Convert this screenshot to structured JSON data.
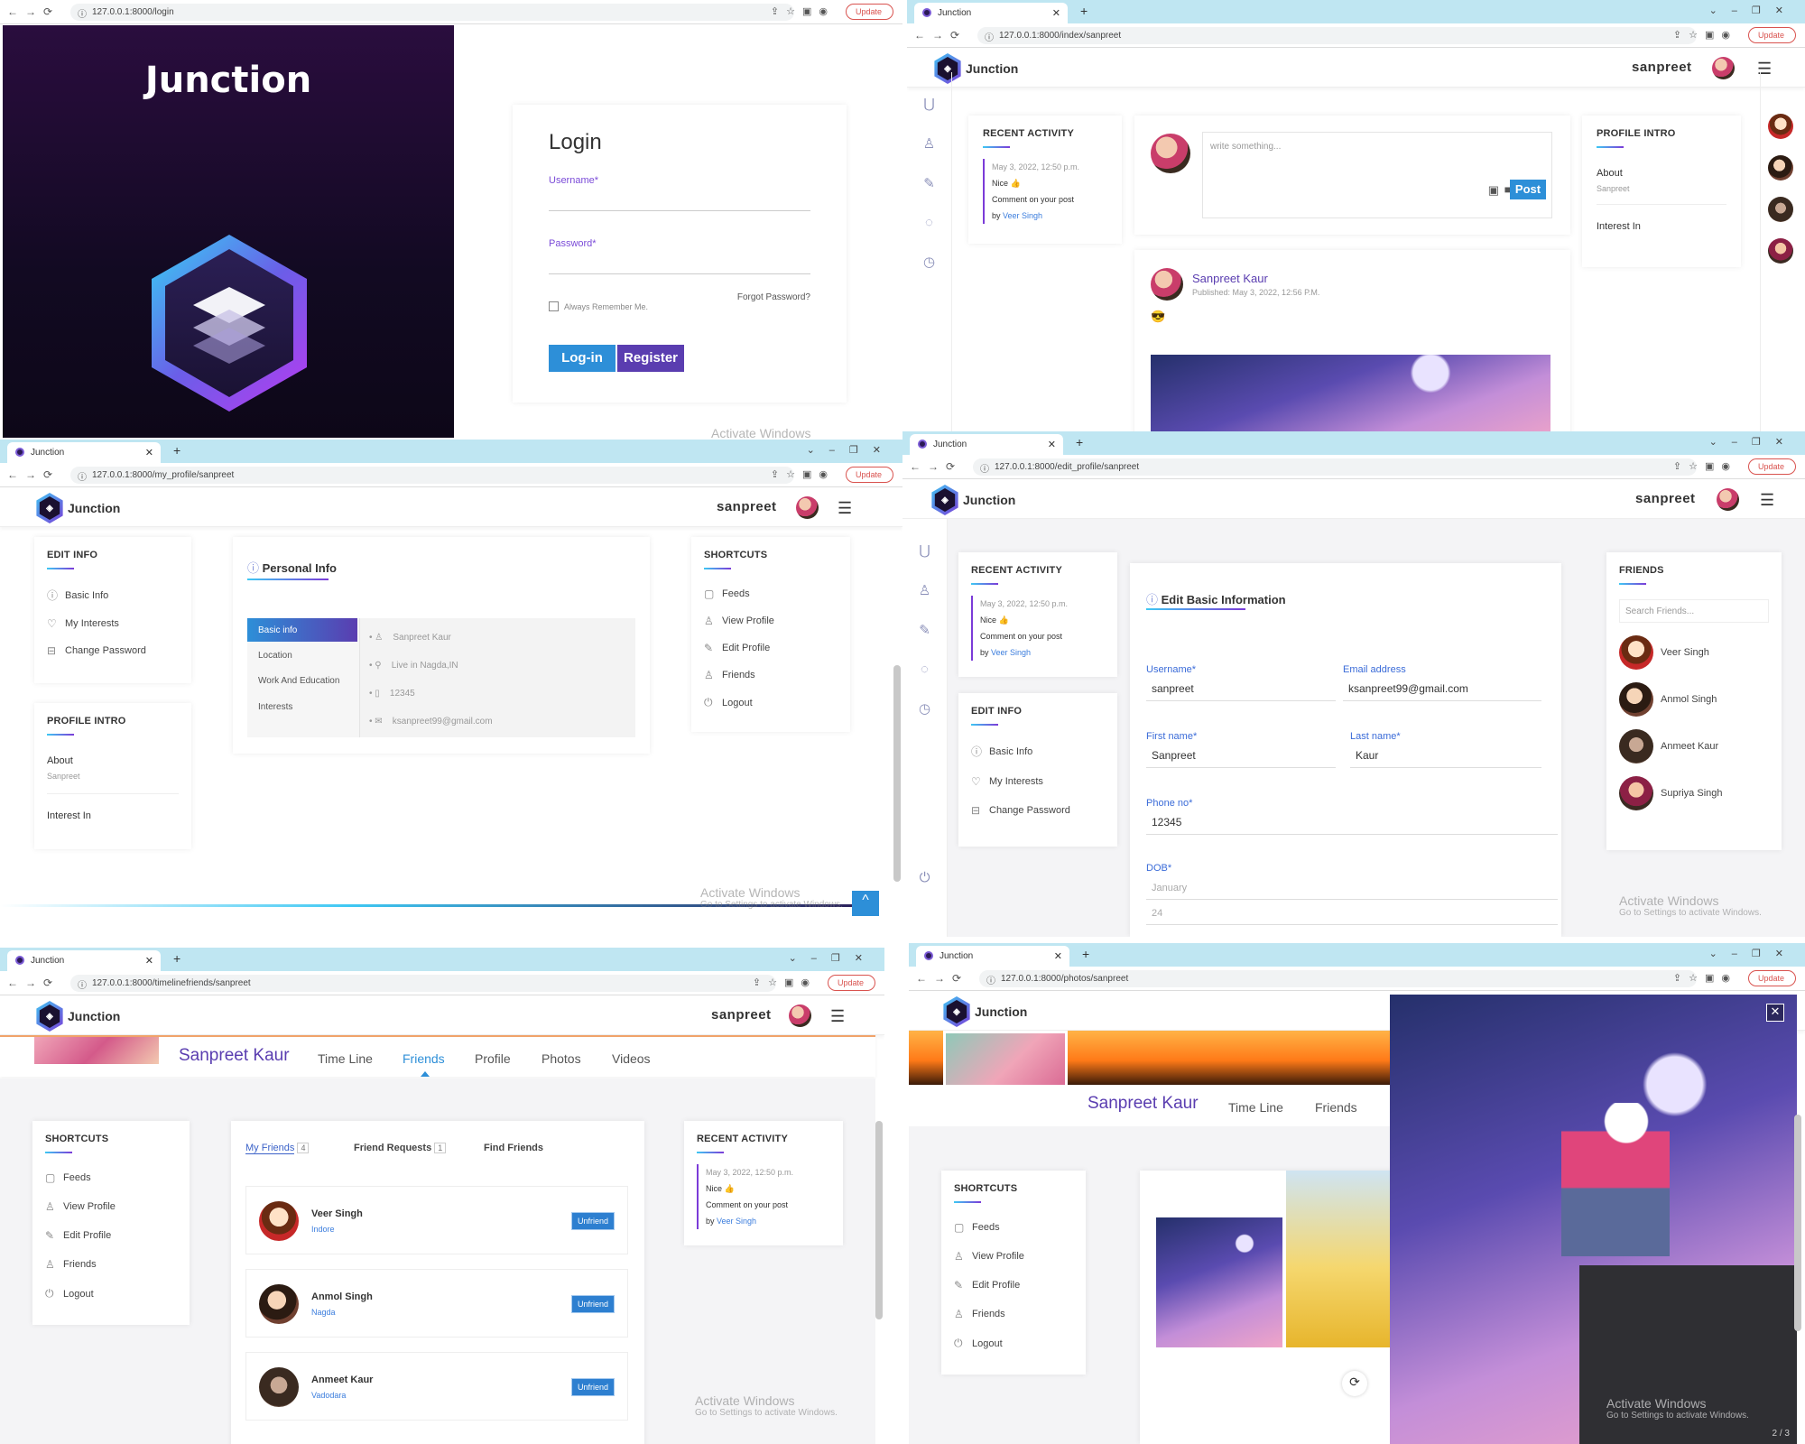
{
  "brand": "Junction",
  "username": "sanpreet",
  "browser": {
    "tab_title": "Junction",
    "update_label": "Update"
  },
  "login": {
    "url": "127.0.0.1:8000/login",
    "title": "Login",
    "username_label": "Username*",
    "password_label": "Password*",
    "remember_label": "Always Remember Me.",
    "forgot_label": "Forgot Password?",
    "login_button": "Log-in",
    "register_button": "Register",
    "watermark": "Activate Windows"
  },
  "index": {
    "url": "127.0.0.1:8000/index/sanpreet",
    "recent_activity": {
      "title": "RECENT ACTIVITY",
      "date": "May 3, 2022, 12:50 p.m.",
      "text": "Nice 👍",
      "action": "Comment on your post",
      "by_prefix": "by",
      "by_name": "Veer Singh"
    },
    "composer": {
      "placeholder": "write something...",
      "post_button": "Post"
    },
    "post": {
      "author": "Sanpreet Kaur",
      "published": "Published: May 3, 2022, 12:56 P.M.",
      "emoji": "😎"
    },
    "profile_intro": {
      "title": "PROFILE INTRO",
      "about_label": "About",
      "about_value": "Sanpreet",
      "interest_label": "Interest In"
    }
  },
  "my_profile": {
    "url": "127.0.0.1:8000/my_profile/sanpreet",
    "edit_info": {
      "title": "EDIT INFO",
      "items": [
        "Basic Info",
        "My Interests",
        "Change Password"
      ]
    },
    "profile_intro": {
      "title": "PROFILE INTRO",
      "about_label": "About",
      "about_value": "Sanpreet",
      "interest_label": "Interest In"
    },
    "personal_info": {
      "title": "Personal Info",
      "tabs": [
        "Basic info",
        "Location",
        "Work And Education",
        "Interests"
      ],
      "values": [
        "Sanpreet Kaur",
        "Live in Nagda,IN",
        "12345",
        "ksanpreet99@gmail.com"
      ]
    },
    "shortcuts": {
      "title": "SHORTCUTS",
      "items": [
        "Feeds",
        "View Profile",
        "Edit Profile",
        "Friends",
        "Logout"
      ]
    },
    "watermark": "Activate Windows",
    "watermark_sub": "Go to Settings to activate Windows."
  },
  "edit_profile": {
    "url": "127.0.0.1:8000/edit_profile/sanpreet",
    "recent_activity": {
      "title": "RECENT ACTIVITY",
      "date": "May 3, 2022, 12:50 p.m.",
      "text": "Nice 👍",
      "action": "Comment on your post",
      "by_prefix": "by",
      "by_name": "Veer Singh"
    },
    "edit_info": {
      "title": "EDIT INFO",
      "items": [
        "Basic Info",
        "My Interests",
        "Change Password"
      ]
    },
    "form": {
      "title": "Edit Basic Information",
      "username_label": "Username*",
      "username": "sanpreet",
      "email_label": "Email address",
      "email": "ksanpreet99@gmail.com",
      "first_label": "First name*",
      "first": "Sanpreet",
      "last_label": "Last name*",
      "last": "Kaur",
      "phone_label": "Phone no*",
      "phone": "12345",
      "dob_label": "DOB*",
      "dob_month": "January",
      "dob_day": "24"
    },
    "friends": {
      "title": "FRIENDS",
      "search_placeholder": "Search Friends...",
      "list": [
        "Veer Singh",
        "Anmol Singh",
        "Anmeet Kaur",
        "Supriya Singh"
      ]
    },
    "watermark": "Activate Windows",
    "watermark_sub": "Go to Settings to activate Windows."
  },
  "timeline_friends": {
    "url": "127.0.0.1:8000/timelinefriends/sanpreet",
    "profile_name": "Sanpreet Kaur",
    "tabs": [
      "Time Line",
      "Friends",
      "Profile",
      "Photos",
      "Videos"
    ],
    "shortcuts": {
      "title": "SHORTCUTS",
      "items": [
        "Feeds",
        "View Profile",
        "Edit Profile",
        "Friends",
        "Logout"
      ]
    },
    "friend_tabs": {
      "my_friends": "My Friends",
      "my_friends_count": "4",
      "requests": "Friend Requests",
      "requests_count": "1",
      "find": "Find Friends"
    },
    "friends": [
      {
        "name": "Veer Singh",
        "city": "Indore"
      },
      {
        "name": "Anmol Singh",
        "city": "Nagda"
      },
      {
        "name": "Anmeet Kaur",
        "city": "Vadodara"
      }
    ],
    "unfriend_label": "Unfriend",
    "recent_activity": {
      "title": "RECENT ACTIVITY",
      "date": "May 3, 2022, 12:50 p.m.",
      "text": "Nice 👍",
      "action": "Comment on your post",
      "by_prefix": "by",
      "by_name": "Veer Singh"
    },
    "watermark": "Activate Windows",
    "watermark_sub": "Go to Settings to activate Windows."
  },
  "photos": {
    "url": "127.0.0.1:8000/photos/sanpreet",
    "profile_name": "Sanpreet Kaur",
    "tabs": [
      "Time Line",
      "Friends"
    ],
    "shortcuts": {
      "title": "SHORTCUTS",
      "items": [
        "Feeds",
        "View Profile",
        "Edit Profile",
        "Friends",
        "Logout"
      ]
    },
    "lightbox_counter": "2 / 3",
    "watermark": "Activate Windows",
    "watermark_sub": "Go to Settings to activate Windows."
  },
  "icons": {
    "shortcuts": [
      "file-icon",
      "user-icon",
      "edit-icon",
      "user-icon",
      "power-icon"
    ],
    "edit_info": [
      "info-icon",
      "heart-icon",
      "lock-icon"
    ]
  }
}
